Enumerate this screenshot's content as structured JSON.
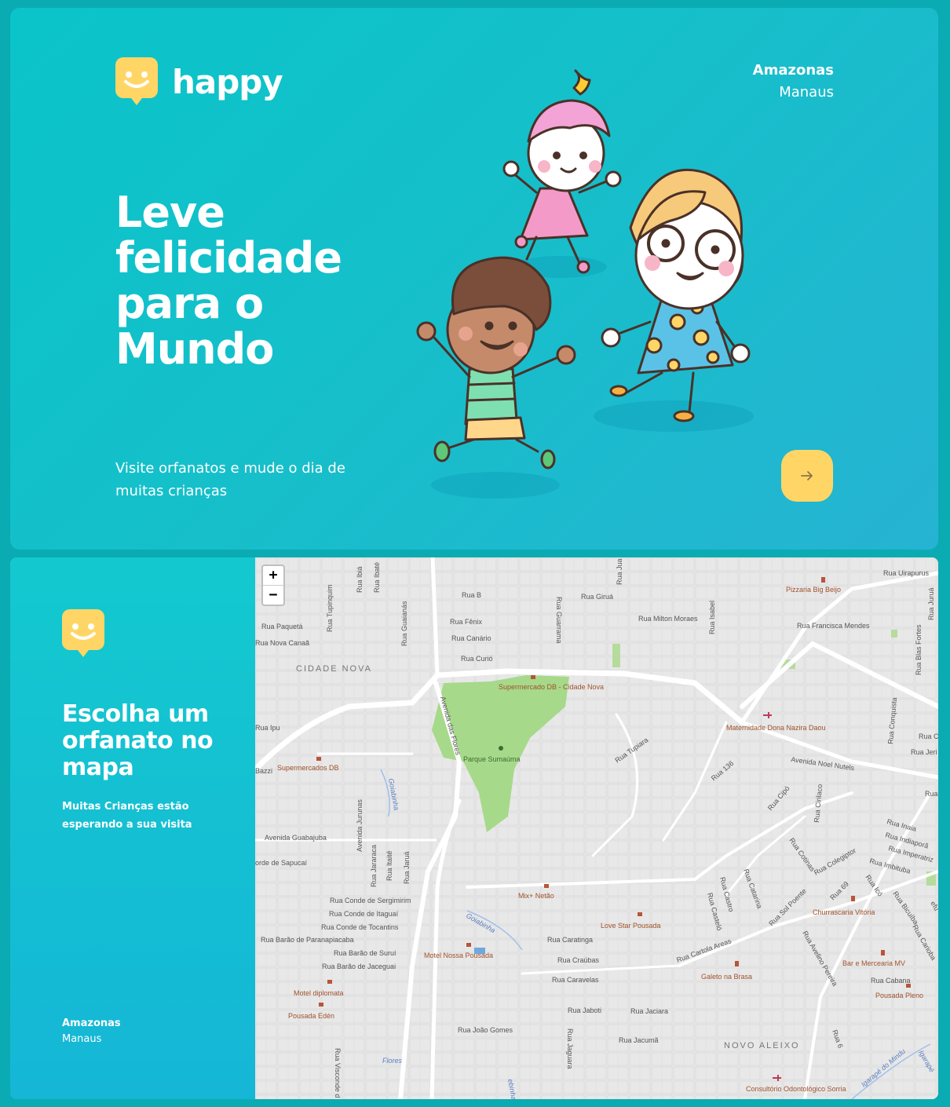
{
  "landing": {
    "brand": "happy",
    "location": {
      "state": "Amazonas",
      "city": "Manaus"
    },
    "headline": "Leve felicidade para o Mundo",
    "subtitle": "Visite orfanatos e mude o dia de muitas crianças",
    "enter_icon": "arrow-right-icon"
  },
  "map_page": {
    "title": "Escolha um orfanato no mapa",
    "description": "Muitas Crianças estão esperando a sua visita",
    "location": {
      "state": "Amazonas",
      "city": "Manaus"
    },
    "zoom": {
      "in": "+",
      "out": "−"
    },
    "map_labels": {
      "streets": [
        "Rua B",
        "Rua Fênix",
        "Rua Canário",
        "Rua Curió",
        "Rua Giruá",
        "Rua Milton Moraes",
        "Rua Paquetá",
        "Rua Nova Canaã",
        "Rua Tupinquim",
        "Rua Ibiá",
        "Rua Ibaté",
        "Rua Guaianás",
        "Rua Guarrama",
        "Rua Jua",
        "Rua Isabel",
        "Rua Uirapurus",
        "Rua Francisca Mendes",
        "Rua Juruá",
        "Rua Blas Fortes",
        "Avenida das Flores",
        "Rua Tupiara",
        "Avenida Noel Nutels",
        "Rua 136",
        "Rua Cipó",
        "Rua Cirilaco",
        "Rua Conquista",
        "Rua C",
        "Rua Jeri",
        "Rua",
        "Avenida Guabajuba",
        "orde de Sapucaí",
        "Avenida Jurunas",
        "Rua Jararaca",
        "Rua Itaitê",
        "Rua Jaruá",
        "Rua Conde de Sergimirim",
        "Rua Conde de Itaguaí",
        "Rua Conde de Tocantins",
        "Rua Barão de Paranapiacaba",
        "Rua Barão de Suruí",
        "Rua Barão de Jaceguai",
        "Rua Caratinga",
        "Rua Craúbas",
        "Rua Caravelas",
        "Rua Jaboti",
        "Rua Jaciara",
        "Rua Jacumã",
        "Rua João Gomes",
        "Rua Jaguara",
        "Rua Visconde d",
        "Rua Cotinas",
        "Rua Catarina",
        "Rua Castro",
        "Rua Casteló",
        "Rua Sol Poente",
        "Rua Colegiptor",
        "Rua 69",
        "Rua Cartola Areas",
        "Rua Avelino Pereira",
        "Rua 6",
        "Rua Cabana",
        "Rua Inaia",
        "Rua Indiaporã",
        "Rua Imperatriz",
        "Rua Imbituba",
        "Rua Icó",
        "Rua Bicuíba",
        "Rua Carioba",
        "Rua Ipu",
        "Bazzi",
        "efu",
        "Rua Ig"
      ],
      "pois": [
        "Pizzaria Big Beijo",
        "Supermercado DB - Cidade Nova",
        "Maternidade Dona Nazira Daou",
        "Supermercados DB",
        "Mix+ Netão",
        "Love Star Pousada",
        "Motel Nossa Pousada",
        "Churrascaria Vitória",
        "Bar e Mercearia MV",
        "Galeto na Brasa",
        "Pousada Pleno",
        "Motel diplomata",
        "Pousada Edén",
        "Consultório Odontológico Sorria"
      ],
      "parks": [
        "Parque Sumaúma"
      ],
      "neighborhoods": [
        "CIDADE NOVA",
        "NOVO ALEIXO"
      ],
      "waterways": [
        "Goiabinha",
        "Goiabinha",
        "Flores",
        "Igarapé do Mindu",
        "Igarapé",
        "ebinha"
      ]
    }
  },
  "colors": {
    "accent_yellow": "#ffd666",
    "background_teal": "#15c3d6",
    "park_green": "#a6d98a"
  }
}
